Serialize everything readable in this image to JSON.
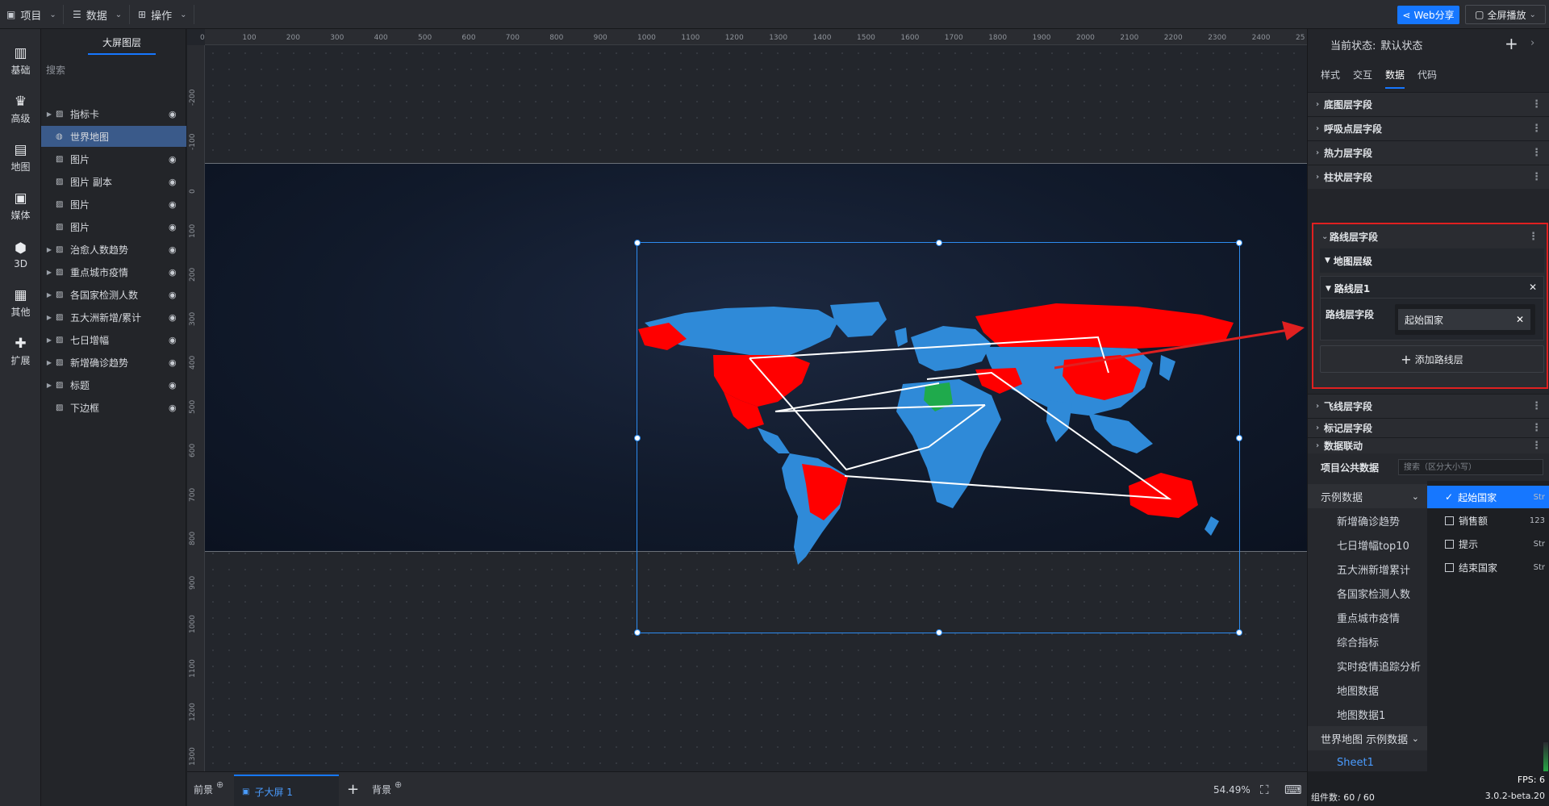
{
  "topbar": {
    "menus": [
      {
        "label": "项目",
        "icon": "project-icon"
      },
      {
        "label": "数据",
        "icon": "database-icon"
      },
      {
        "label": "操作",
        "icon": "grid-icon"
      }
    ],
    "web_share": "Web分享",
    "fullscreen": "全屏播放"
  },
  "rail": [
    "基础",
    "高级",
    "地图",
    "媒体",
    "3D",
    "其他",
    "扩展"
  ],
  "layers": {
    "title": "大屏图层",
    "search_placeholder": "搜索",
    "items": [
      {
        "name": "指标卡",
        "group": true
      },
      {
        "name": "世界地图",
        "group": false,
        "selected": true
      },
      {
        "name": "图片",
        "group": false
      },
      {
        "name": "图片 副本",
        "group": false
      },
      {
        "name": "图片",
        "group": false
      },
      {
        "name": "图片",
        "group": false
      },
      {
        "name": "治愈人数趋势",
        "group": true
      },
      {
        "name": "重点城市疫情",
        "group": true
      },
      {
        "name": "各国家检测人数",
        "group": true
      },
      {
        "name": "五大洲新增/累计",
        "group": true
      },
      {
        "name": "七日增幅",
        "group": true
      },
      {
        "name": "新增确诊趋势",
        "group": true
      },
      {
        "name": "标题",
        "group": true
      },
      {
        "name": "下边框",
        "group": false
      }
    ]
  },
  "ruler": {
    "top": [
      "0",
      "100",
      "200",
      "300",
      "400",
      "500",
      "600",
      "700",
      "800",
      "900",
      "1000",
      "1100",
      "1200",
      "1300",
      "1400",
      "1500",
      "1600",
      "1700",
      "1800",
      "1900",
      "2000",
      "2100",
      "2200",
      "2300",
      "2400",
      "25"
    ],
    "left": [
      "-200",
      "-100",
      "0",
      "100",
      "200",
      "300",
      "400",
      "500",
      "600",
      "700",
      "800",
      "900",
      "1000",
      "1100",
      "1200",
      "1300"
    ]
  },
  "bottom": {
    "front": "前景",
    "sub_tab": "子大屏 1",
    "background": "背景",
    "zoom": "54.49%"
  },
  "right": {
    "current_state_label": "当前状态:",
    "current_state_value": "默认状态",
    "tabs": [
      "样式",
      "交互",
      "数据",
      "代码"
    ],
    "active_tab": "数据",
    "sections_top": [
      "底图层字段",
      "呼吸点层字段",
      "热力层字段",
      "柱状层字段"
    ],
    "route_section": "路线层字段",
    "map_level": "地图层级",
    "route_layer": "路线层1",
    "route_field_label": "路线层字段",
    "route_field_value": "起始国家",
    "add_route": "添加路线层",
    "sections_bottom": [
      "飞线层字段",
      "标记层字段",
      "数据联动"
    ],
    "public_data_label": "项目公共数据",
    "public_search_placeholder": "搜索（区分大小写）",
    "dataset_groups": [
      {
        "name": "示例数据",
        "items": [
          "新增确诊趋势",
          "七日增幅top10",
          "五大洲新增累计",
          "各国家检测人数",
          "重点城市疫情",
          "综合指标",
          "实时疫情追踪分析",
          "地图数据",
          "地图数据1"
        ]
      },
      {
        "name": "世界地图 示例数据",
        "items": [
          "Sheet1"
        ]
      }
    ],
    "fields": [
      {
        "name": "起始国家",
        "type": "Str",
        "selected": true
      },
      {
        "name": "销售额",
        "type": "123",
        "selected": false
      },
      {
        "name": "提示",
        "type": "Str",
        "selected": false
      },
      {
        "name": "结束国家",
        "type": "Str",
        "selected": false
      }
    ],
    "fps": "FPS: 6",
    "component_count": "组件数: 60 / 60",
    "version": "3.0.2-beta.20"
  },
  "colors": {
    "accent": "#1677ff",
    "highlight_box": "#e02020",
    "map_land": "#2f8ad8",
    "map_route_country": "#ff0000",
    "map_special": "#1faa4c",
    "route_line": "#ffffff"
  }
}
